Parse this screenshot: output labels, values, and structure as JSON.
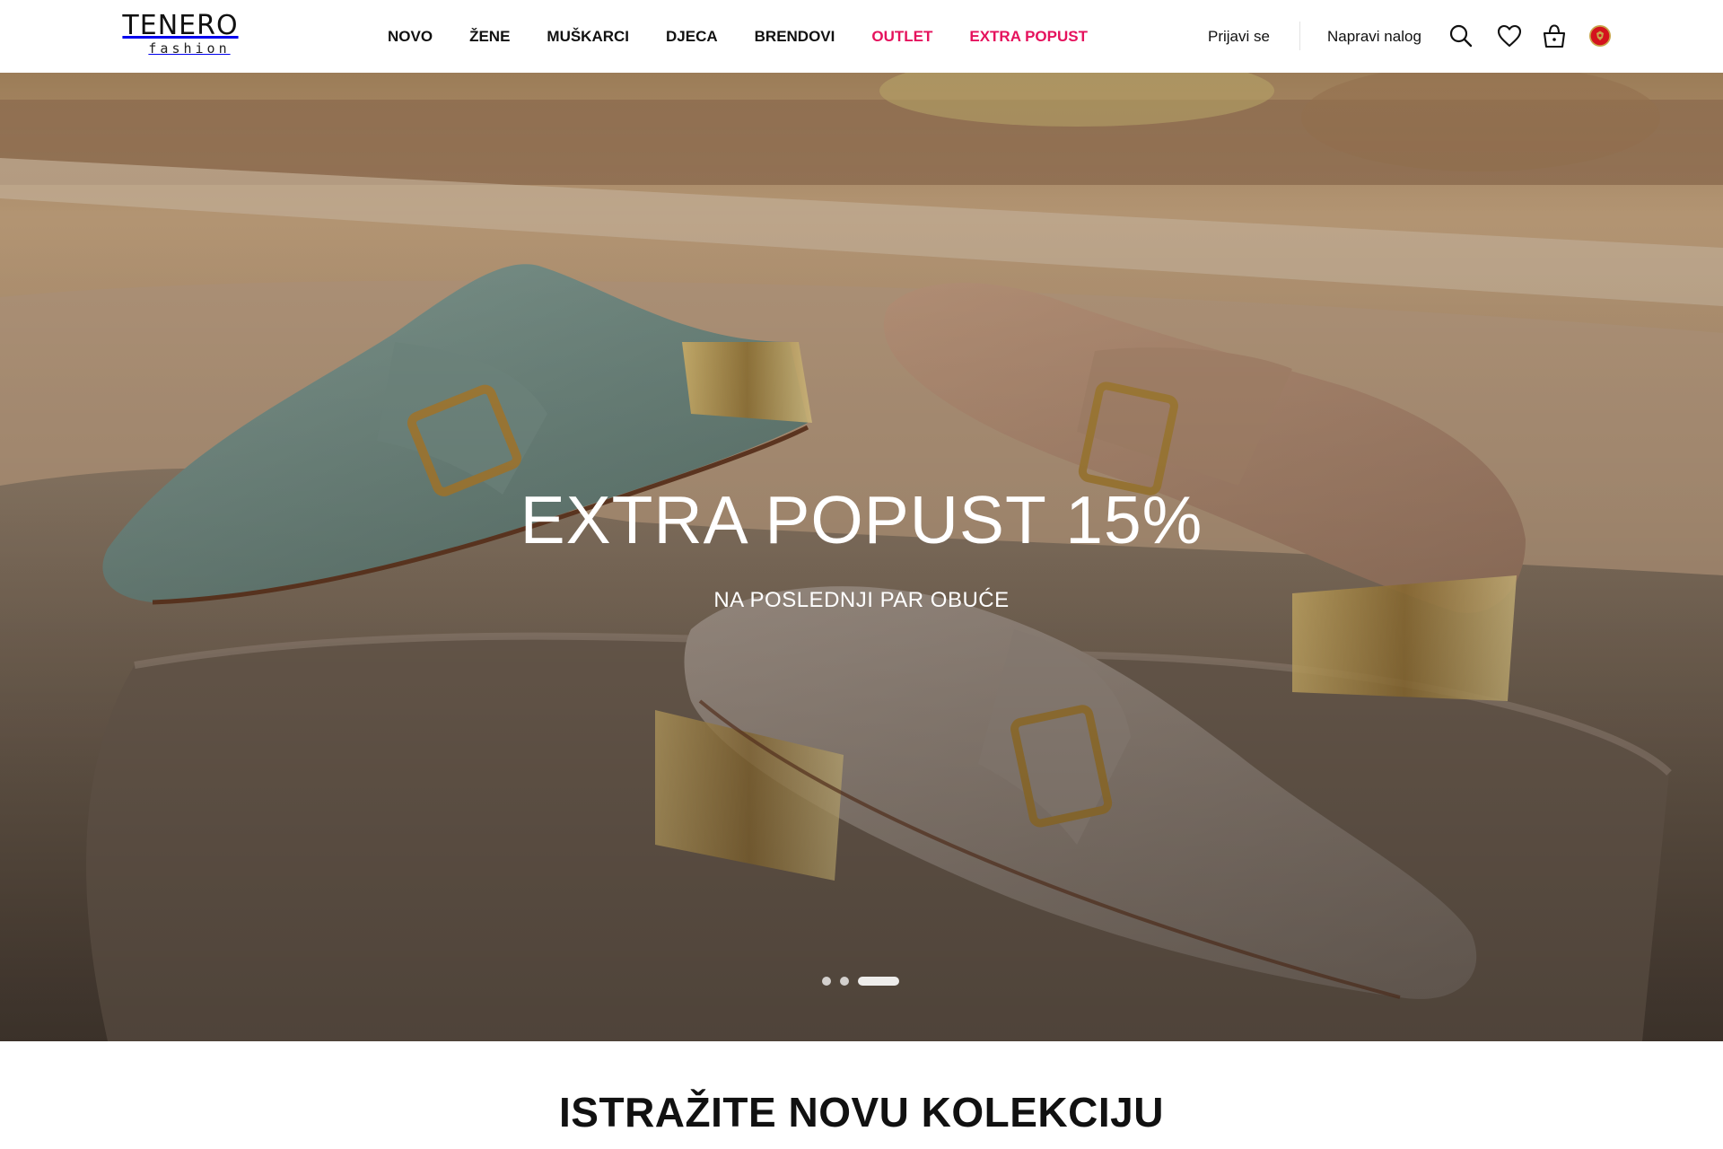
{
  "brand": {
    "name": "TENERO",
    "tagline": "fashion"
  },
  "nav": {
    "items": [
      {
        "label": "NOVO",
        "accent": false
      },
      {
        "label": "ŽENE",
        "accent": false
      },
      {
        "label": "MUŠKARCI",
        "accent": false
      },
      {
        "label": "DJECA",
        "accent": false
      },
      {
        "label": "BRENDOVI",
        "accent": false
      },
      {
        "label": "OUTLET",
        "accent": true
      },
      {
        "label": "EXTRA POPUST",
        "accent": true
      }
    ]
  },
  "account": {
    "login_label": "Prijavi se",
    "register_label": "Napravi nalog"
  },
  "icons": [
    "search-icon",
    "heart-icon",
    "shopping-bag-icon",
    "montenegro-flag-icon"
  ],
  "hero": {
    "title": "EXTRA POPUST 15%",
    "subtitle": "NA POSLEDNJI PAR OBUĆE",
    "slides_total": 3,
    "active_slide": 3
  },
  "section": {
    "title": "ISTRAŽITE NOVU KOLEKCIJU"
  },
  "colors": {
    "accent": "#e5125d",
    "text": "#111111",
    "background": "#ffffff",
    "flag_red": "#d4131d",
    "flag_gold": "#c8a54a"
  }
}
